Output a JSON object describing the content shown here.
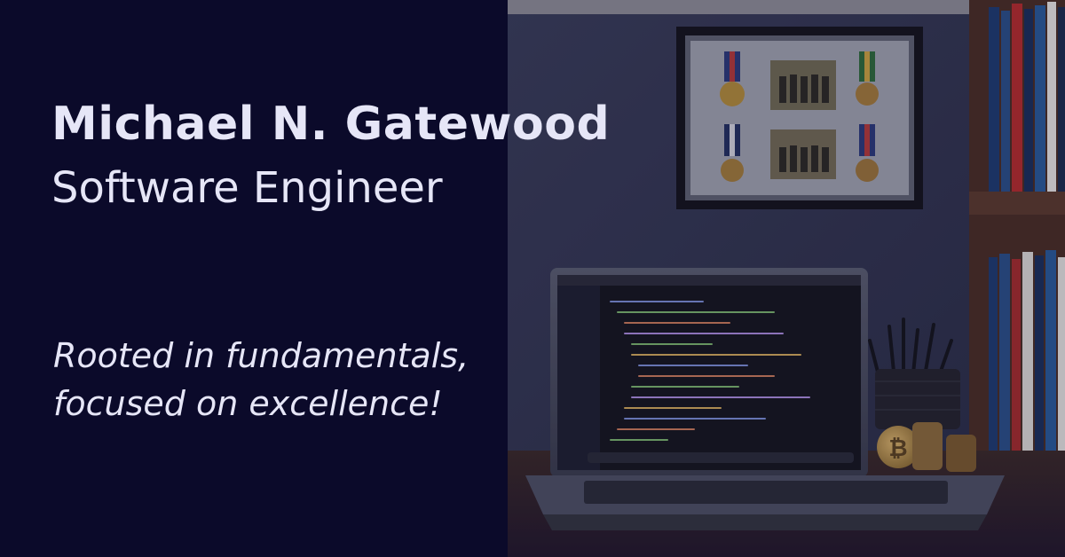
{
  "profile": {
    "name": "Michael N. Gatewood",
    "title": "Software Engineer"
  },
  "tagline": {
    "line1": "Rooted in fundamentals,",
    "line2": "focused on excellence!"
  },
  "colors": {
    "panel_background": "#0b0a2a",
    "text": "#e6e6f7"
  },
  "icons": [
    "shadow-box-frame-icon",
    "laptop-icon",
    "pen-holder-icon",
    "bitcoin-coin-icon",
    "bookshelf-icon"
  ]
}
